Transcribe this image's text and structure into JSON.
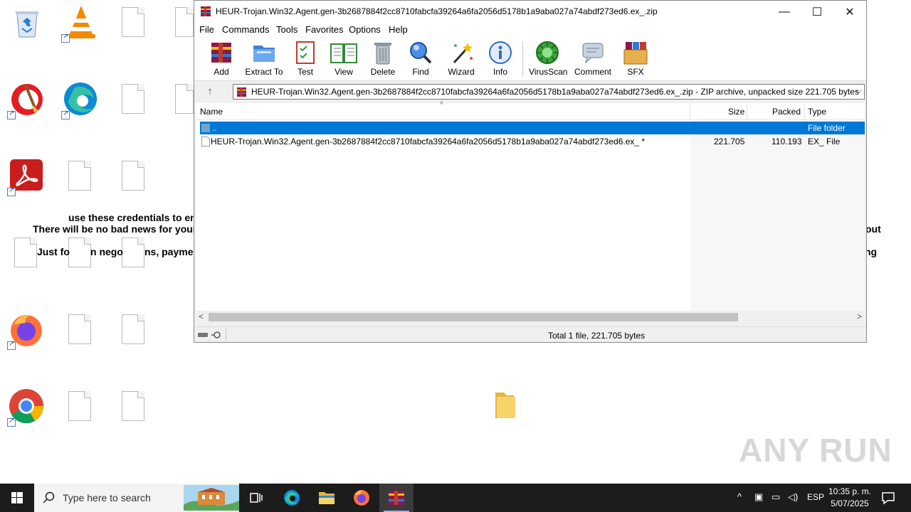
{
  "desktop": {
    "note_lines": [
      "use these credentials to en",
      "There will be no bad news for your",
      "Just fo",
      "n nego",
      "ns, payme",
      "out",
      "ng"
    ]
  },
  "window": {
    "title": "HEUR-Trojan.Win32.Agent.gen-3b2687884f2cc8710fabcfa39264a6fa2056d5178b1a9aba027a74abdf273ed6.ex_.zip",
    "controls": {
      "minimize": "—",
      "maximize": "☐",
      "close": "✕"
    },
    "menu": [
      "File",
      "Commands",
      "Tools",
      "Favorites",
      "Options",
      "Help"
    ],
    "toolbar": [
      "Add",
      "Extract To",
      "Test",
      "View",
      "Delete",
      "Find",
      "Wizard",
      "Info",
      "VirusScan",
      "Comment",
      "SFX"
    ],
    "address": {
      "path": "HEUR-Trojan.Win32.Agent.gen-3b2687884f2cc8710fabcfa39264a6fa2056d5178b1a9aba027a74abdf273ed6.ex_.zip - ZIP archive, unpacked size 221.705 bytes"
    },
    "columns": {
      "name": "Name",
      "size": "Size",
      "packed": "Packed",
      "type": "Type"
    },
    "rows": [
      {
        "name": "..",
        "size": "",
        "packed": "",
        "type": "File folder",
        "selected": true
      },
      {
        "name": "HEUR-Trojan.Win32.Agent.gen-3b2687884f2cc8710fabcfa39264a6fa2056d5178b1a9aba027a74abdf273ed6.ex_ *",
        "size": "221.705",
        "packed": "110.193",
        "type": "EX_ File",
        "selected": false
      }
    ],
    "status": "Total 1 file, 221.705 bytes"
  },
  "taskbar": {
    "search_placeholder": "Type here to search",
    "language": "ESP",
    "time": "10:35 p. m.",
    "date": "5/07/2025"
  },
  "watermark": "ANY RUN",
  "colors": {
    "selection": "#0078d7",
    "taskbar": "#1c1c1c"
  }
}
